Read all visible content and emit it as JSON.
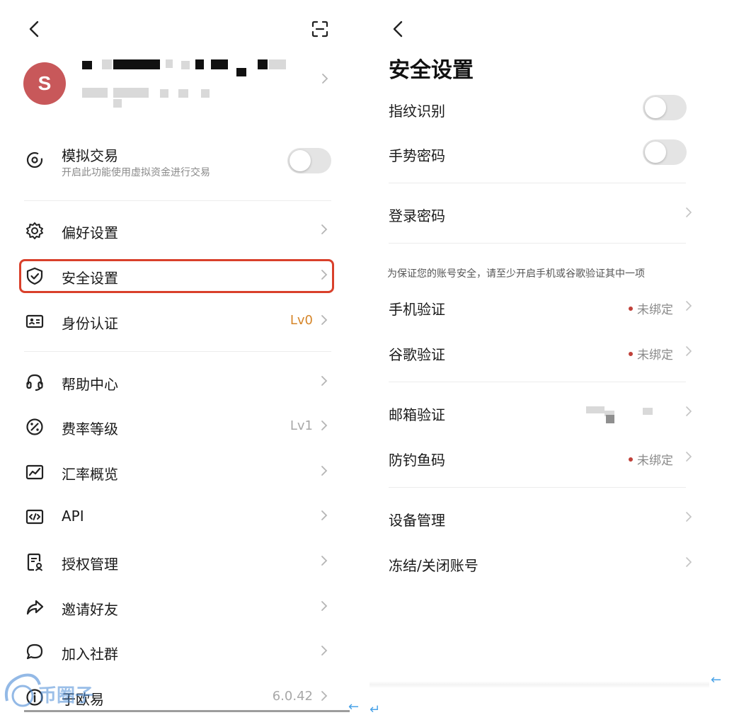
{
  "left": {
    "profile": {
      "avatar_letter": "S"
    },
    "simulated_trading": {
      "label": "模拟交易",
      "sub": "开启此功能使用虚拟资金进行交易",
      "enabled": false
    },
    "menu": [
      {
        "key": "preferences",
        "label": "偏好设置",
        "icon": "gear-icon",
        "value": ""
      },
      {
        "key": "security",
        "label": "安全设置",
        "icon": "shield-check-icon",
        "value": ""
      },
      {
        "key": "identity",
        "label": "身份认证",
        "icon": "id-card-icon",
        "value": "Lv0"
      },
      {
        "key": "help",
        "label": "帮助中心",
        "icon": "headset-icon",
        "value": ""
      },
      {
        "key": "fee",
        "label": "费率等级",
        "icon": "percent-icon",
        "value": "Lv1"
      },
      {
        "key": "rates",
        "label": "汇率概览",
        "icon": "trend-chart-icon",
        "value": ""
      },
      {
        "key": "api",
        "label": "API",
        "icon": "code-icon",
        "value": ""
      },
      {
        "key": "auth",
        "label": "授权管理",
        "icon": "authorization-doc-icon",
        "value": ""
      },
      {
        "key": "invite",
        "label": "邀请好友",
        "icon": "share-arrow-icon",
        "value": ""
      },
      {
        "key": "community",
        "label": "加入社群",
        "icon": "chat-bubble-icon",
        "value": ""
      },
      {
        "key": "about",
        "label": "于欧易",
        "icon": "info-icon",
        "value": "6.0.42"
      }
    ],
    "colors": {
      "lv0": "#d6862a",
      "highlight": "#d9402b"
    }
  },
  "right": {
    "title": "安全设置",
    "toggles": [
      {
        "label": "指纹识别",
        "enabled": false
      },
      {
        "label": "手势密码",
        "enabled": false
      }
    ],
    "login_password": "登录密码",
    "note": "为保证您的账号安全，请至少开启手机或谷歌验证其中一项",
    "verifications": [
      {
        "label": "手机验证",
        "status": "未绑定"
      },
      {
        "label": "谷歌验证",
        "status": "未绑定"
      }
    ],
    "email": {
      "label": "邮箱验证"
    },
    "anti_phishing": {
      "label": "防钓鱼码",
      "status": "未绑定"
    },
    "device": "设备管理",
    "freeze": "冻结/关闭账号"
  },
  "watermark": "币圈子"
}
